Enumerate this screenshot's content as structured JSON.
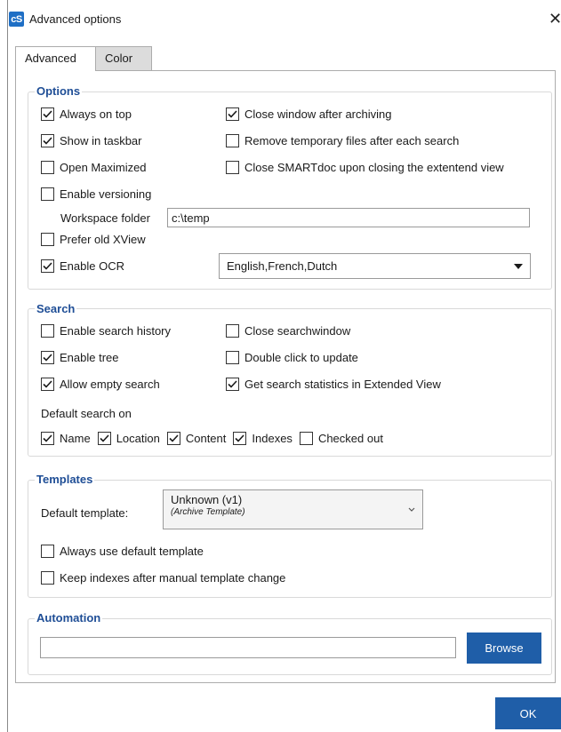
{
  "window": {
    "title": "Advanced options",
    "app_icon_text": "cS",
    "close_glyph": "✕"
  },
  "tabs": [
    {
      "label": "Advanced",
      "selected": true
    },
    {
      "label": "Color",
      "selected": false
    }
  ],
  "options": {
    "title": "Options",
    "always_on_top": {
      "label": "Always on top",
      "checked": true
    },
    "close_window_after_archiving": {
      "label": "Close window after archiving",
      "checked": true
    },
    "show_in_taskbar": {
      "label": "Show in taskbar",
      "checked": true
    },
    "remove_temp_files": {
      "label": "Remove temporary files after each search",
      "checked": false
    },
    "open_maximized": {
      "label": "Open Maximized",
      "checked": false
    },
    "close_smartdoc": {
      "label": "Close SMARTdoc upon closing the extentend view",
      "checked": false
    },
    "enable_versioning": {
      "label": "Enable versioning",
      "checked": false
    },
    "workspace_folder": {
      "label": "Workspace folder",
      "value": "c:\\temp"
    },
    "prefer_old_xview": {
      "label": "Prefer old XView",
      "checked": false
    },
    "enable_ocr": {
      "label": "Enable OCR",
      "checked": true
    },
    "ocr_languages": {
      "value": "English,French,Dutch"
    }
  },
  "search": {
    "title": "Search",
    "enable_search_history": {
      "label": "Enable search history",
      "checked": false
    },
    "close_searchwindow": {
      "label": "Close searchwindow",
      "checked": false
    },
    "enable_tree": {
      "label": "Enable tree",
      "checked": true
    },
    "double_click_to_update": {
      "label": "Double click to update",
      "checked": false
    },
    "allow_empty_search": {
      "label": "Allow empty search",
      "checked": true
    },
    "get_search_statistics": {
      "label": "Get search statistics in Extended View",
      "checked": true
    },
    "default_search_on_label": "Default search on",
    "default_search_on": [
      {
        "label": "Name",
        "checked": true
      },
      {
        "label": "Location",
        "checked": true
      },
      {
        "label": "Content",
        "checked": true
      },
      {
        "label": "Indexes",
        "checked": true
      },
      {
        "label": "Checked out",
        "checked": false
      }
    ]
  },
  "templates": {
    "title": "Templates",
    "default_template_label": "Default template:",
    "default_template": {
      "name": "Unknown (v1)",
      "subtitle": "(Archive Template)"
    },
    "always_use_default": {
      "label": "Always use default template",
      "checked": false
    },
    "keep_indexes": {
      "label": "Keep indexes after manual template change",
      "checked": false
    }
  },
  "automation": {
    "title": "Automation",
    "path_value": "",
    "browse_label": "Browse"
  },
  "footer": {
    "ok_label": "OK"
  },
  "colors": {
    "accent": "#1f5ea8",
    "group_title": "#1f4e96"
  }
}
